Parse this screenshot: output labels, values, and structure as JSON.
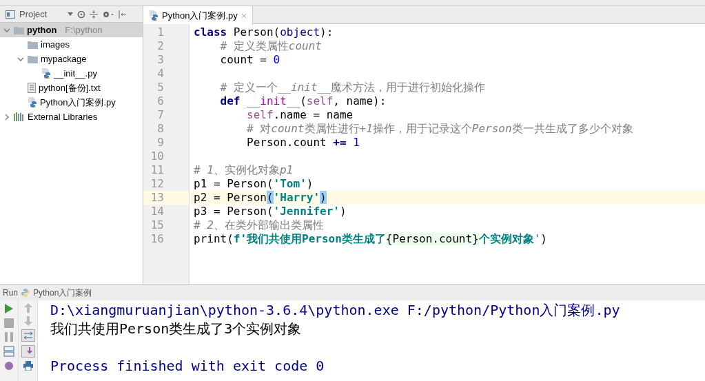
{
  "project_panel": {
    "title": "Project",
    "tree": [
      {
        "label": "python",
        "path": "F:\\python",
        "kind": "folder",
        "expanded": true,
        "selected": true,
        "children": [
          {
            "label": "images",
            "kind": "folder"
          },
          {
            "label": "mypackage",
            "kind": "folder",
            "expanded": true,
            "children": [
              {
                "label": "__init__.py",
                "kind": "python"
              }
            ]
          },
          {
            "label": "python[备份].txt",
            "kind": "text"
          },
          {
            "label": "Python入门案例.py",
            "kind": "python"
          }
        ]
      },
      {
        "label": "External Libraries",
        "kind": "library",
        "expanded": false,
        "selected": false
      }
    ]
  },
  "editor": {
    "tabs": [
      {
        "label": "Python入门案例.py",
        "selected": true
      }
    ],
    "lines": [
      {
        "num": "1",
        "current": false,
        "tokens": [
          {
            "kind": "kw",
            "text": "class"
          },
          {
            "kind": "plain",
            "text": " Person("
          },
          {
            "kind": "builtin",
            "text": "object"
          },
          {
            "kind": "plain",
            "text": "):"
          }
        ]
      },
      {
        "num": "2",
        "current": false,
        "tokens": [
          {
            "kind": "comment",
            "text": "    # 定义类属性"
          },
          {
            "kind": "comment_italic",
            "text": "count"
          }
        ]
      },
      {
        "num": "3",
        "current": false,
        "tokens": [
          {
            "kind": "plain",
            "text": "    count = "
          },
          {
            "kind": "number",
            "text": "0"
          }
        ]
      },
      {
        "num": "4",
        "current": false
      },
      {
        "num": "5",
        "current": false,
        "tokens": [
          {
            "kind": "comment",
            "text": "    # 定义一个__"
          },
          {
            "kind": "comment_italic",
            "text": "init"
          },
          {
            "kind": "comment",
            "text": "__魔术方法，用于进行初始化操作"
          }
        ]
      },
      {
        "num": "6",
        "current": false,
        "tokens": [
          {
            "kind": "kw",
            "text": "    def "
          },
          {
            "kind": "magic",
            "text": "__init__"
          },
          {
            "kind": "plain",
            "text": "("
          },
          {
            "kind": "self",
            "text": "self"
          },
          {
            "kind": "plain",
            "text": ", name):"
          }
        ]
      },
      {
        "num": "7",
        "current": false,
        "tokens": [
          {
            "kind": "self",
            "text": "        self"
          },
          {
            "kind": "plain",
            "text": ".name = name"
          }
        ]
      },
      {
        "num": "8",
        "current": false,
        "tokens": [
          {
            "kind": "comment",
            "text": "        # 对"
          },
          {
            "kind": "comment_italic",
            "text": "count"
          },
          {
            "kind": "comment",
            "text": "类属性进行"
          },
          {
            "kind": "comment_italic",
            "text": "+1"
          },
          {
            "kind": "comment",
            "text": "操作，用于记录这个"
          },
          {
            "kind": "comment_italic",
            "text": "Person"
          },
          {
            "kind": "comment",
            "text": "类一共生成了多少个对象"
          }
        ]
      },
      {
        "num": "9",
        "current": false,
        "tokens": [
          {
            "kind": "plain",
            "text": "        Person.count "
          },
          {
            "kind": "kw",
            "text": "+= "
          },
          {
            "kind": "number",
            "text": "1"
          }
        ]
      },
      {
        "num": "10",
        "current": false
      },
      {
        "num": "11",
        "current": false,
        "tokens": [
          {
            "kind": "comment",
            "text": "# "
          },
          {
            "kind": "comment_italic",
            "text": "1"
          },
          {
            "kind": "comment",
            "text": "、实例化对象"
          },
          {
            "kind": "comment_italic",
            "text": "p1"
          }
        ]
      },
      {
        "num": "12",
        "current": false,
        "tokens": [
          {
            "kind": "plain",
            "text": "p1 = Person("
          },
          {
            "kind": "string",
            "text": "'Tom'"
          },
          {
            "kind": "plain",
            "text": ")"
          }
        ]
      },
      {
        "num": "13",
        "current": true,
        "tokens": [
          {
            "kind": "plain",
            "text": "p2 = Person"
          },
          {
            "kind": "bracket_match",
            "text": "("
          },
          {
            "kind": "string",
            "text": "'Harry'"
          },
          {
            "kind": "bracket_match",
            "text": ")"
          }
        ]
      },
      {
        "num": "14",
        "current": false,
        "tokens": [
          {
            "kind": "plain",
            "text": "p3 = Person("
          },
          {
            "kind": "string",
            "text": "'Jennifer'"
          },
          {
            "kind": "plain",
            "text": ")"
          }
        ]
      },
      {
        "num": "15",
        "current": false,
        "tokens": [
          {
            "kind": "comment",
            "text": "# "
          },
          {
            "kind": "comment_italic",
            "text": "2"
          },
          {
            "kind": "comment",
            "text": "、在类外部输出类属性"
          }
        ]
      },
      {
        "num": "16",
        "current": false,
        "tokens": [
          {
            "kind": "plain",
            "text": "print("
          },
          {
            "kind": "string",
            "text": "f'我们共使用Person类生成了"
          },
          {
            "kind": "interp",
            "text": "{Person.count}"
          },
          {
            "kind": "string",
            "text": "个实例对象"
          },
          {
            "kind": "string_plain",
            "text": "'"
          },
          {
            "kind": "plain",
            "text": ")"
          }
        ]
      }
    ]
  },
  "run_panel": {
    "title": "Run",
    "config": "Python入门案例",
    "output": [
      {
        "kind": "system",
        "text": "D:\\xiangmuruanjian\\python-3.6.4\\python.exe F:/python/Python入门案例.py"
      },
      {
        "kind": "stdout",
        "text": "我们共使用Person类生成了3个实例对象"
      },
      {
        "kind": "blank"
      },
      {
        "kind": "system",
        "text": "Process finished with exit code 0"
      }
    ]
  }
}
